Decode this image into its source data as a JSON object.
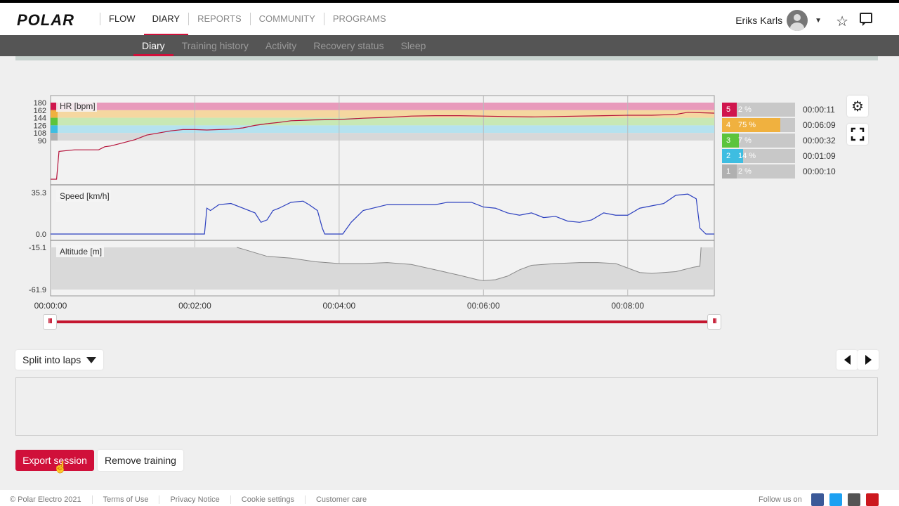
{
  "header": {
    "logo": "POLAR",
    "nav": [
      {
        "label": "FLOW"
      },
      {
        "label": "DIARY"
      },
      {
        "label": "REPORTS"
      },
      {
        "label": "COMMUNITY"
      },
      {
        "label": "PROGRAMS"
      }
    ],
    "active_nav": "DIARY",
    "user_name": "Eriks Karls"
  },
  "subnav": {
    "items": [
      "Diary",
      "Training history",
      "Activity",
      "Recovery status",
      "Sleep"
    ],
    "active": "Diary"
  },
  "chart_data": {
    "type": "line",
    "x_ticks": [
      "00:00:00",
      "00:02:00",
      "00:04:00",
      "00:06:00",
      "00:08:00"
    ],
    "x_unit": "seconds",
    "x_range": [
      0,
      552
    ],
    "series": [
      {
        "name": "HR [bpm]",
        "color": "#b5123a",
        "y_ticks": [
          "180",
          "162",
          "144",
          "126",
          "108",
          "90"
        ],
        "zones": [
          {
            "min": 162,
            "max": 180,
            "color": "#e89abb"
          },
          {
            "min": 144,
            "max": 162,
            "color": "#f5d7a0"
          },
          {
            "min": 126,
            "max": 144,
            "color": "#c8e8b4"
          },
          {
            "min": 108,
            "max": 126,
            "color": "#b5e2ef"
          },
          {
            "min": 90,
            "max": 108,
            "color": "#d8d8d8"
          }
        ],
        "points": [
          [
            0,
            40
          ],
          [
            5,
            40
          ],
          [
            7,
            76
          ],
          [
            20,
            78
          ],
          [
            40,
            78
          ],
          [
            45,
            82
          ],
          [
            50,
            83
          ],
          [
            60,
            87
          ],
          [
            70,
            92
          ],
          [
            80,
            103
          ],
          [
            90,
            108
          ],
          [
            100,
            113
          ],
          [
            110,
            116
          ],
          [
            120,
            116
          ],
          [
            130,
            115
          ],
          [
            140,
            116
          ],
          [
            150,
            117
          ],
          [
            160,
            120
          ],
          [
            170,
            126
          ],
          [
            180,
            130
          ],
          [
            190,
            133
          ],
          [
            200,
            137
          ],
          [
            220,
            139
          ],
          [
            240,
            140
          ],
          [
            260,
            143
          ],
          [
            280,
            145
          ],
          [
            300,
            148
          ],
          [
            320,
            149
          ],
          [
            340,
            149
          ],
          [
            360,
            148
          ],
          [
            380,
            147
          ],
          [
            400,
            146
          ],
          [
            420,
            147
          ],
          [
            440,
            148
          ],
          [
            460,
            149
          ],
          [
            480,
            150
          ],
          [
            500,
            150
          ],
          [
            520,
            152
          ],
          [
            530,
            157
          ],
          [
            540,
            156
          ],
          [
            552,
            155
          ]
        ]
      },
      {
        "name": "Speed [km/h]",
        "color": "#2b3fbf",
        "y_ticks": [
          "35.3",
          "0.0"
        ],
        "y_range": [
          0,
          35.3
        ],
        "points": [
          [
            0,
            0
          ],
          [
            120,
            0
          ],
          [
            128,
            0
          ],
          [
            130,
            22
          ],
          [
            133,
            20
          ],
          [
            140,
            25
          ],
          [
            150,
            26
          ],
          [
            160,
            22
          ],
          [
            170,
            18
          ],
          [
            175,
            10
          ],
          [
            180,
            12
          ],
          [
            185,
            20
          ],
          [
            190,
            22
          ],
          [
            200,
            27
          ],
          [
            210,
            28
          ],
          [
            215,
            25
          ],
          [
            222,
            20
          ],
          [
            226,
            5
          ],
          [
            228,
            0
          ],
          [
            243,
            0
          ],
          [
            250,
            10
          ],
          [
            260,
            20
          ],
          [
            280,
            25
          ],
          [
            300,
            25
          ],
          [
            320,
            25
          ],
          [
            330,
            27
          ],
          [
            350,
            27
          ],
          [
            360,
            23
          ],
          [
            370,
            22
          ],
          [
            380,
            18
          ],
          [
            390,
            16
          ],
          [
            400,
            18
          ],
          [
            410,
            14
          ],
          [
            420,
            15
          ],
          [
            430,
            11
          ],
          [
            440,
            10
          ],
          [
            450,
            12
          ],
          [
            460,
            18
          ],
          [
            470,
            16
          ],
          [
            480,
            16
          ],
          [
            490,
            22
          ],
          [
            500,
            24
          ],
          [
            510,
            26
          ],
          [
            520,
            33
          ],
          [
            530,
            34
          ],
          [
            537,
            30
          ],
          [
            540,
            5
          ],
          [
            545,
            0
          ],
          [
            552,
            0
          ]
        ]
      },
      {
        "name": "Altitude [m]",
        "color": "#888888",
        "y_ticks": [
          "-15.1",
          "-61.9"
        ],
        "y_range": [
          -61.9,
          -15.1
        ],
        "points": [
          [
            0,
            -15.1
          ],
          [
            155,
            -15.1
          ],
          [
            160,
            -17
          ],
          [
            170,
            -21
          ],
          [
            180,
            -25
          ],
          [
            190,
            -26
          ],
          [
            200,
            -27
          ],
          [
            220,
            -31
          ],
          [
            240,
            -33
          ],
          [
            260,
            -33
          ],
          [
            280,
            -32
          ],
          [
            300,
            -34
          ],
          [
            320,
            -40
          ],
          [
            340,
            -46
          ],
          [
            355,
            -51
          ],
          [
            360,
            -52
          ],
          [
            370,
            -51
          ],
          [
            380,
            -47
          ],
          [
            390,
            -40
          ],
          [
            400,
            -35
          ],
          [
            420,
            -33
          ],
          [
            440,
            -32
          ],
          [
            455,
            -32
          ],
          [
            470,
            -33
          ],
          [
            480,
            -38
          ],
          [
            490,
            -43
          ],
          [
            500,
            -44
          ],
          [
            520,
            -42
          ],
          [
            535,
            -37
          ],
          [
            540,
            -36
          ],
          [
            541,
            -15.1
          ],
          [
            552,
            -15.1
          ]
        ]
      }
    ]
  },
  "hr_zones": [
    {
      "zone": "5",
      "percent": "2 %",
      "time": "00:00:11",
      "fraction": 0.02,
      "color": "#d0154d"
    },
    {
      "zone": "4",
      "percent": "75 %",
      "time": "00:06:09",
      "fraction": 0.75,
      "color": "#f0b13f"
    },
    {
      "zone": "3",
      "percent": "7 %",
      "time": "00:00:32",
      "fraction": 0.07,
      "color": "#5cc43c"
    },
    {
      "zone": "2",
      "percent": "14 %",
      "time": "00:01:09",
      "fraction": 0.14,
      "color": "#3ebde1"
    },
    {
      "zone": "1",
      "percent": "2 %",
      "time": "00:00:10",
      "fraction": 0.02,
      "color": "#b0b0b0"
    }
  ],
  "controls": {
    "split_label": "Split into laps",
    "export_label": "Export session",
    "remove_label": "Remove training"
  },
  "footer": {
    "links": [
      "© Polar Electro 2021",
      "Terms of Use",
      "Privacy Notice",
      "Cookie settings",
      "Customer care"
    ],
    "follow_label": "Follow us on"
  }
}
